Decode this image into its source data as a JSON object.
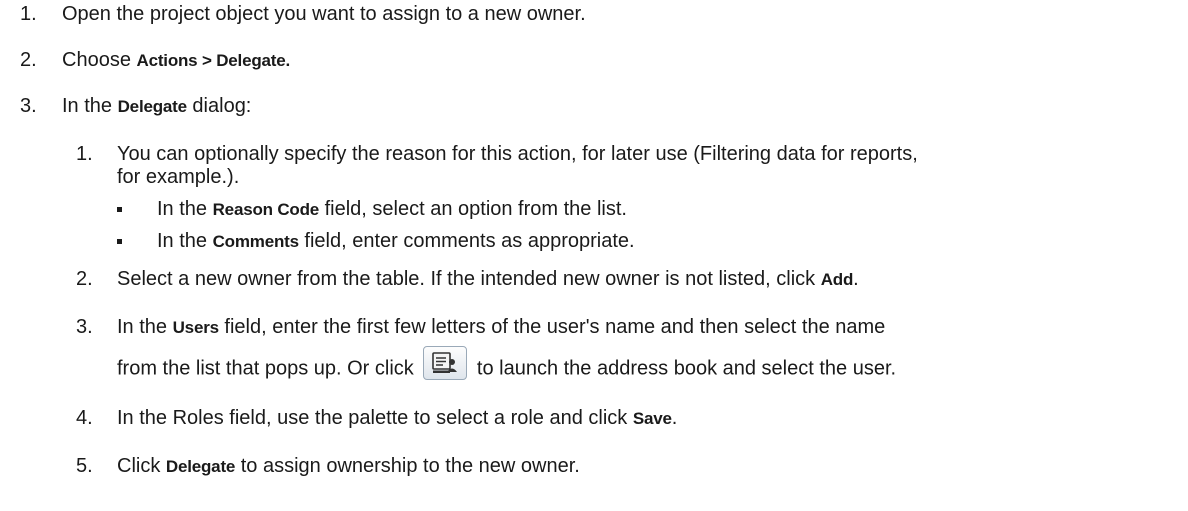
{
  "steps": [
    {
      "number": "1.",
      "parts": [
        "Open the project object you want to assign to a new owner."
      ]
    },
    {
      "number": "2.",
      "prefix": "Choose ",
      "bold": "Actions > Delegate."
    },
    {
      "number": "3.",
      "prefix": "In the ",
      "bold": "Delegate",
      "suffix": " dialog:"
    }
  ],
  "substeps": [
    {
      "number": "1.",
      "line1": "You can optionally specify the reason for this action, for later use (Filtering data for reports,",
      "line2": "for example.).",
      "bullets": [
        {
          "prefix": "In the ",
          "bold": "Reason Code",
          "suffix": " field, select an option from the list."
        },
        {
          "prefix": "In the ",
          "bold": "Comments",
          "suffix": " field, enter comments as appropriate."
        }
      ]
    },
    {
      "number": "2.",
      "prefix": "Select a new owner from the table. If the intended new owner is not listed, click ",
      "bold": "Add",
      "suffix": "."
    },
    {
      "number": "3.",
      "prefix": "In the ",
      "bold": "Users",
      "suffix": " field, enter the first few letters of the user's name and then select the name",
      "line2_prefix": "from the list that pops up. Or click ",
      "line2_icon": "address-book-icon",
      "line2_suffix": " to launch the address book and select the user."
    },
    {
      "number": "4.",
      "prefix": "In the Roles field, use the palette to select a role and click ",
      "bold": "Save",
      "suffix": "."
    },
    {
      "number": "5.",
      "prefix": "Click ",
      "bold": "Delegate",
      "suffix": " to assign ownership to the new owner."
    }
  ]
}
